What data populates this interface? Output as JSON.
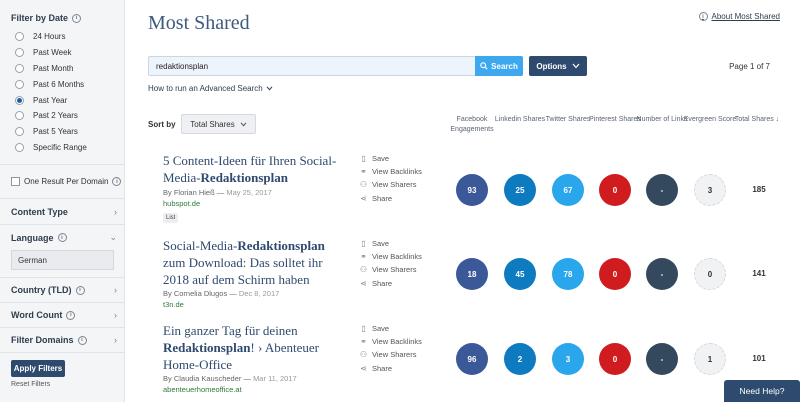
{
  "sidebar": {
    "filter_by_date": "Filter by Date",
    "date_options": [
      {
        "label": "24 Hours",
        "selected": false
      },
      {
        "label": "Past Week",
        "selected": false
      },
      {
        "label": "Past Month",
        "selected": false
      },
      {
        "label": "Past 6 Months",
        "selected": false
      },
      {
        "label": "Past Year",
        "selected": true
      },
      {
        "label": "Past 2 Years",
        "selected": false
      },
      {
        "label": "Past 5 Years",
        "selected": false
      },
      {
        "label": "Specific Range",
        "selected": false
      }
    ],
    "one_result_per_domain": "One Result Per Domain",
    "content_type": "Content Type",
    "language": "Language",
    "language_value": "German",
    "country": "Country (TLD)",
    "word_count": "Word Count",
    "filter_domains": "Filter Domains",
    "apply_filters": "Apply Filters",
    "reset_filters": "Reset Filters"
  },
  "header": {
    "title": "Most Shared",
    "about_link": "About Most Shared"
  },
  "search": {
    "value": "redaktionsplan",
    "button": "Search",
    "options": "Options",
    "page_of": "Page 1 of 7",
    "advanced": "How to run an Advanced Search"
  },
  "sort": {
    "label": "Sort by",
    "value": "Total Shares"
  },
  "columns": [
    "Facebook Engagements",
    "Linkedin Shares",
    "Twitter Shares",
    "Pinterest Shares",
    "Number of Links",
    "Evergreen Score",
    "Total Shares ↓"
  ],
  "actions": [
    "Save",
    "View Backlinks",
    "View Sharers",
    "Share"
  ],
  "results": [
    {
      "title_plain": "5 Content-Ideen für Ihren Social-Media-",
      "title_bold": "Redaktionsplan",
      "title_rest": "",
      "author": "By Florian Hieß",
      "date": "May 25, 2017",
      "domain": "hubspot.de",
      "tag": "List",
      "facebook": "93",
      "linkedin": "25",
      "twitter": "67",
      "pinterest": "0",
      "links": "-",
      "evergreen": "3",
      "total": "185"
    },
    {
      "title_plain": "Social-Media-",
      "title_bold": "Redaktionsplan",
      "title_rest": " zum Download: Das solltet ihr 2018 auf dem Schirm haben",
      "author": "By Cornelia Dlugos",
      "date": "Dec 8, 2017",
      "domain": "t3n.de",
      "tag": "",
      "facebook": "18",
      "linkedin": "45",
      "twitter": "78",
      "pinterest": "0",
      "links": "-",
      "evergreen": "0",
      "total": "141"
    },
    {
      "title_plain": "Ein ganzer Tag für deinen ",
      "title_bold": "Redaktionsplan",
      "title_rest": "! › Abenteuer Home-Office",
      "author": "By Claudia Kauscheder",
      "date": "Mar 11, 2017",
      "domain": "abenteuerhomeoffice.at",
      "tag": "",
      "facebook": "96",
      "linkedin": "2",
      "twitter": "3",
      "pinterest": "0",
      "links": "-",
      "evergreen": "1",
      "total": "101"
    }
  ],
  "need_help": "Need Help?",
  "colors": {
    "facebook": "#3b5998",
    "linkedin": "#0e7abf",
    "twitter": "#29a6ec",
    "pinterest": "#d01c1f",
    "links": "#35495e",
    "primary_button": "#2e4a6e",
    "search_button": "#3ea8ef"
  }
}
